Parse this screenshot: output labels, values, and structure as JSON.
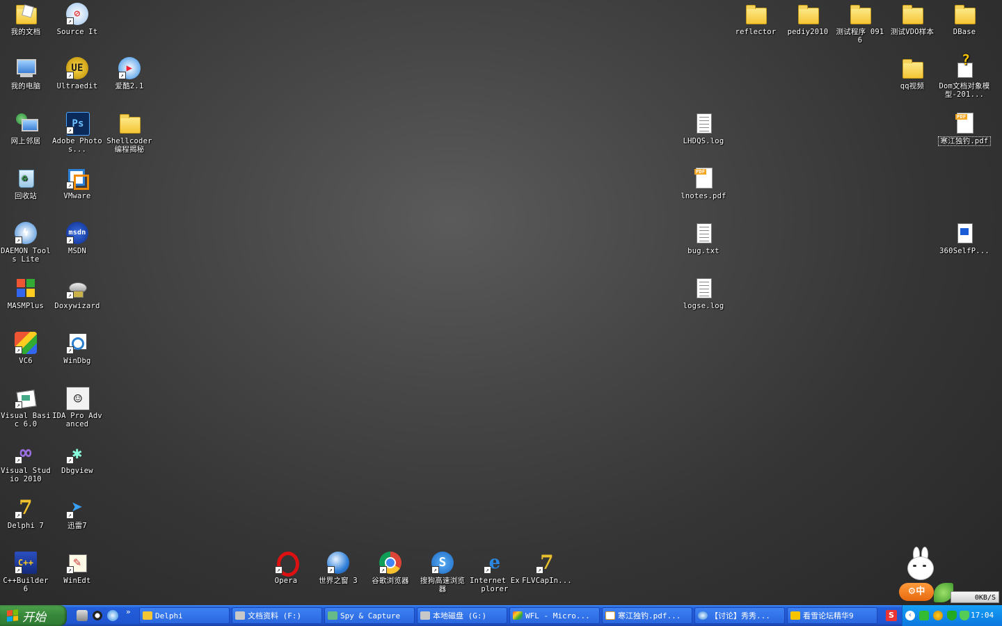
{
  "desktop": {
    "left_icons": [
      {
        "label": "我的文档",
        "icon": "my-documents-icon"
      },
      {
        "label": "Source It",
        "icon": "source-it-icon"
      },
      {
        "label": "我的电脑",
        "icon": "my-computer-icon"
      },
      {
        "label": "Ultraedit",
        "icon": "ultraedit-icon"
      },
      {
        "label": "爱酷2.1",
        "icon": "player-icon"
      },
      {
        "label": "网上邻居",
        "icon": "network-icon"
      },
      {
        "label": "Adobe Photos...",
        "icon": "photoshop-icon"
      },
      {
        "label": "Shellcoder 编程揭秘",
        "icon": "folder-icon"
      },
      {
        "label": "回收站",
        "icon": "recycle-bin-icon"
      },
      {
        "label": "VMware",
        "icon": "vmware-icon"
      },
      {
        "label": "DAEMON Tools Lite",
        "icon": "daemon-tools-icon"
      },
      {
        "label": "MSDN",
        "icon": "msdn-icon"
      },
      {
        "label": "MASMPlus",
        "icon": "masmplus-icon"
      },
      {
        "label": "Doxywizard",
        "icon": "doxywizard-icon"
      },
      {
        "label": "VC6",
        "icon": "vc6-icon"
      },
      {
        "label": "WinDbg",
        "icon": "windbg-icon"
      },
      {
        "label": "Visual Basic 6.0",
        "icon": "visual-basic-icon"
      },
      {
        "label": "IDA Pro Advanced",
        "icon": "ida-pro-icon"
      },
      {
        "label": "Visual Studio 2010",
        "icon": "visual-studio-icon"
      },
      {
        "label": "Dbgview",
        "icon": "dbgview-icon"
      },
      {
        "label": "Delphi 7",
        "icon": "delphi-icon"
      },
      {
        "label": "迅雷7",
        "icon": "thunder-icon"
      },
      {
        "label": "C++Builder 6",
        "icon": "cpp-builder-icon"
      },
      {
        "label": "WinEdt",
        "icon": "winedt-icon"
      }
    ],
    "bottom_icons": [
      {
        "label": "Opera",
        "icon": "opera-icon"
      },
      {
        "label": "世界之窗 3",
        "icon": "theworld-browser-icon"
      },
      {
        "label": "谷歌浏览器",
        "icon": "chrome-icon"
      },
      {
        "label": "搜狗高速浏览器",
        "icon": "sogou-browser-icon"
      },
      {
        "label": "Internet Explorer",
        "icon": "ie-icon"
      },
      {
        "label": "FLVCapIn...",
        "icon": "flvcap-icon"
      }
    ],
    "right_icons": [
      {
        "label": "reflector",
        "icon": "folder-icon"
      },
      {
        "label": "pediy2010",
        "icon": "folder-icon"
      },
      {
        "label": "测试程序 0916",
        "icon": "folder-icon"
      },
      {
        "label": "测试VDO样本",
        "icon": "folder-icon"
      },
      {
        "label": "DBase",
        "icon": "folder-icon"
      },
      {
        "label": "qq视频",
        "icon": "folder-icon"
      },
      {
        "label": "Dom文档对象模型-201...",
        "icon": "help-file-icon"
      },
      {
        "label": "LHDQS.log",
        "icon": "text-file-icon"
      },
      {
        "label": "寒江独钓.pdf",
        "icon": "pdf-file-icon"
      },
      {
        "label": "lnotes.pdf",
        "icon": "pdf-file-icon"
      },
      {
        "label": "bug.txt",
        "icon": "text-file-icon"
      },
      {
        "label": "360SelfP...",
        "icon": "exe-file-icon"
      },
      {
        "label": "logse.log",
        "icon": "text-file-icon"
      }
    ]
  },
  "taskbar": {
    "start_label": "开始",
    "tasks": [
      {
        "label": "Delphi"
      },
      {
        "label": "文档资料 (F:)"
      },
      {
        "label": "Spy & Capture"
      },
      {
        "label": "本地磁盘 (G:)"
      },
      {
        "label": "WFL - Micro..."
      },
      {
        "label": "寒江独钓.pdf..."
      },
      {
        "label": "【讨论】秀秀..."
      },
      {
        "label": "看雪论坛精华9"
      }
    ],
    "clock": "17:04",
    "net_speed": "0KB/S",
    "ime_label": "中"
  },
  "colors": {
    "taskbar_blue": "#245edb",
    "start_green": "#37873a",
    "tray_blue": "#0b77e0",
    "folder_yellow": "#f4c534"
  }
}
